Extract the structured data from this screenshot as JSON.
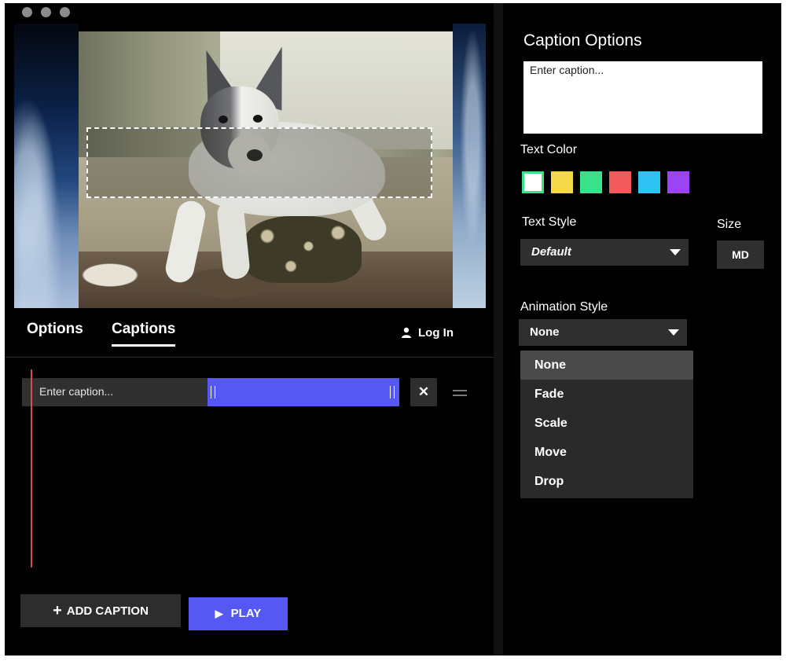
{
  "preview": {
    "caption_overlay": ""
  },
  "tabs": [
    {
      "label": "Options"
    },
    {
      "label": "Captions"
    }
  ],
  "account": {
    "login_label": "Log In"
  },
  "timeline": {
    "caption_placeholder": "Enter caption...",
    "remove_label": "✕"
  },
  "buttons": {
    "add_caption": "ADD CAPTION",
    "add_icon": "plus-icon",
    "play": "PLAY",
    "play_icon": "play-icon"
  },
  "panel": {
    "title": "Caption Options",
    "caption_placeholder": "Enter caption...",
    "text_color_label": "Text Color",
    "colors": [
      "#ffffff",
      "#f5d94a",
      "#39e28a",
      "#f15a5a",
      "#2ec3f2",
      "#9b45f2"
    ],
    "selected_color": "#ffffff",
    "text_style_label": "Text Style",
    "text_style_value": "Default",
    "size_label": "Size",
    "size_value": "MD",
    "animation_label": "Animation Style",
    "animation_value": "None",
    "animation_options": [
      "None",
      "Fade",
      "Scale",
      "Move",
      "Drop"
    ]
  },
  "accent_color": "#5558f2",
  "playhead_color": "#e2484c"
}
